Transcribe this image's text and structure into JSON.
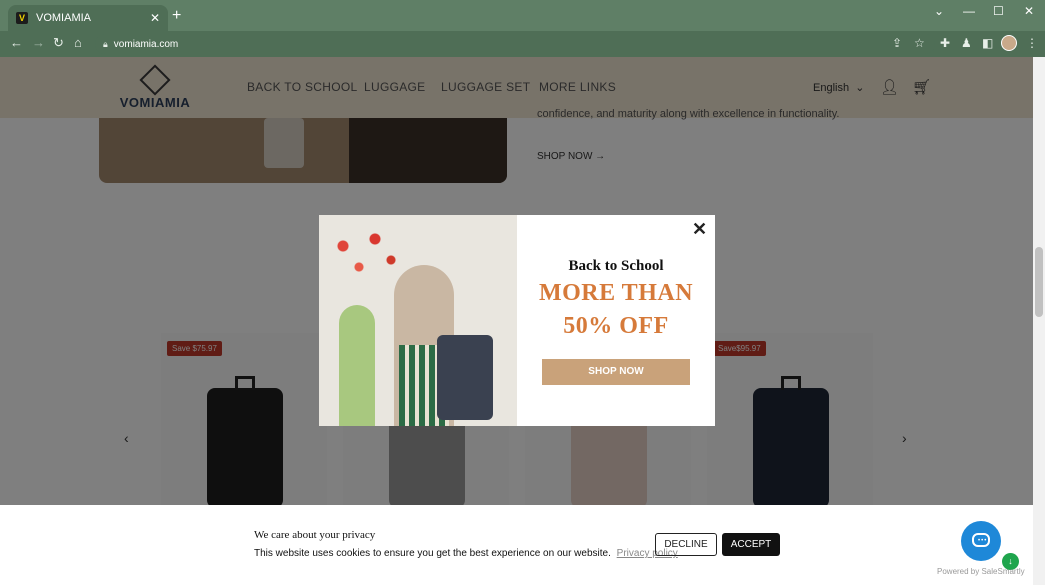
{
  "browser": {
    "tab_title": "VOMIAMIA",
    "favicon_letter": "V",
    "url": "vomiamia.com",
    "icons": [
      "back-icon",
      "forward-icon",
      "reload-icon",
      "home-icon",
      "lock-icon",
      "share-icon",
      "star-icon",
      "extensions-icon",
      "profile-icon",
      "sidebar-icon",
      "menu-icon"
    ]
  },
  "site": {
    "logo": "VOMIAMIA",
    "nav": [
      "BACK TO SCHOOL",
      "LUGGAGE",
      "LUGGAGE SET",
      "MORE LINKS"
    ],
    "language": "English",
    "banner_text": "confidence, and maturity along with excellence in functionality.",
    "shop_now_link": "SHOP NOW →",
    "products": [
      {
        "badge": "Save $75.97",
        "color": "#1f1f1f"
      },
      {
        "badge": "",
        "color": "#9a9a9a"
      },
      {
        "badge": "",
        "color": "#e6d0c6"
      },
      {
        "badge": "Save$95.97",
        "color": "#1e2636"
      }
    ]
  },
  "popup": {
    "title": "Back to School",
    "headline_1": "MORE THAN",
    "headline_2": "50% OFF",
    "button": "SHOP NOW",
    "close": "✕"
  },
  "cookie": {
    "title": "We care about your privacy",
    "text": "This website uses cookies to ensure you get the best experience on our website.",
    "link": "Privacy policy",
    "decline": "DECLINE",
    "accept": "ACCEPT"
  },
  "widget": {
    "powered_by": "Powered by SaleSmartly"
  },
  "colors": {
    "chrome": "#5f7f66",
    "header": "#f1e6d3",
    "popup_accent": "#d67a3a",
    "popup_button": "#c9a27a",
    "chat": "#1e88d8"
  }
}
